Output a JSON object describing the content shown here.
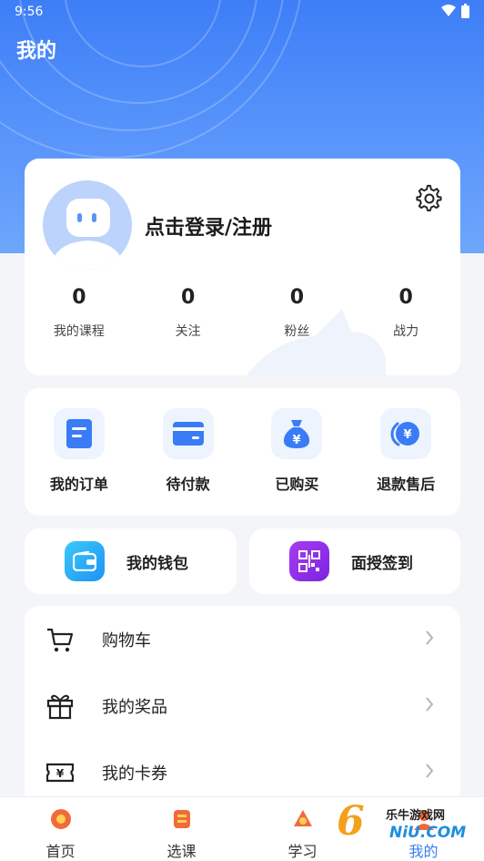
{
  "status_bar": {
    "time": "9:56"
  },
  "header": {
    "title": "我的"
  },
  "profile": {
    "login_text": "点击登录/注册",
    "stats": [
      {
        "value": "0",
        "label": "我的课程"
      },
      {
        "value": "0",
        "label": "关注"
      },
      {
        "value": "0",
        "label": "粉丝"
      },
      {
        "value": "0",
        "label": "战力"
      }
    ]
  },
  "orders": [
    {
      "label": "我的订单",
      "icon": "document-icon"
    },
    {
      "label": "待付款",
      "icon": "card-icon"
    },
    {
      "label": "已购买",
      "icon": "money-bag-icon"
    },
    {
      "label": "退款售后",
      "icon": "refund-icon"
    }
  ],
  "quick": {
    "wallet": {
      "label": "我的钱包",
      "icon": "wallet-icon",
      "color": "#1fa8f5"
    },
    "checkin": {
      "label": "面授签到",
      "icon": "qr-code-icon",
      "color": "#8f2be8"
    }
  },
  "menu": [
    {
      "label": "购物车",
      "icon": "cart-icon"
    },
    {
      "label": "我的奖品",
      "icon": "gift-icon"
    },
    {
      "label": "我的卡券",
      "icon": "coupon-icon"
    }
  ],
  "tabs": [
    {
      "label": "首页",
      "icon": "home-icon"
    },
    {
      "label": "选课",
      "icon": "course-icon"
    },
    {
      "label": "学习",
      "icon": "study-icon"
    },
    {
      "label": "我的",
      "icon": "me-icon"
    }
  ],
  "watermark": {
    "logo": "6",
    "site": "乐牛游戏网",
    "domain": "NiU.COM"
  },
  "colors": {
    "primary": "#3a7cf6",
    "hero_top": "#3d7ef7"
  }
}
